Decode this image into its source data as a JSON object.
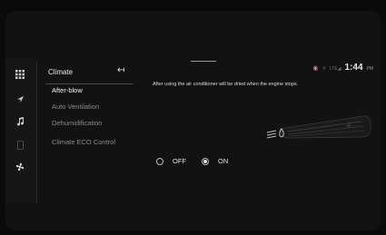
{
  "menu": {
    "title": "Climate",
    "back_icon": "back-arrow-icon",
    "items": [
      {
        "label": "After-blow",
        "active": true
      },
      {
        "label": "Auto Ventilation",
        "active": false
      },
      {
        "label": "Dehumidification",
        "active": false
      },
      {
        "label": "Climate ECO Control",
        "active": false
      }
    ]
  },
  "rail": {
    "icons": [
      "apps-grid-icon",
      "navigation-icon",
      "music-note-icon",
      "phone-icon",
      "fan-icon"
    ]
  },
  "status": {
    "icons": [
      "mute-icon",
      "location-icon",
      "lte-signal-icon"
    ],
    "lte_label": "LTE",
    "time": "1:44",
    "ampm": "PM"
  },
  "content": {
    "description": "After using the air conditioner will be dried when the engine stops.",
    "options": [
      {
        "label": "OFF",
        "selected": false
      },
      {
        "label": "ON",
        "selected": true
      }
    ]
  },
  "colors": {
    "background": "#121212",
    "text_primary": "#e6e6e6",
    "text_muted": "#8a8a8a"
  }
}
